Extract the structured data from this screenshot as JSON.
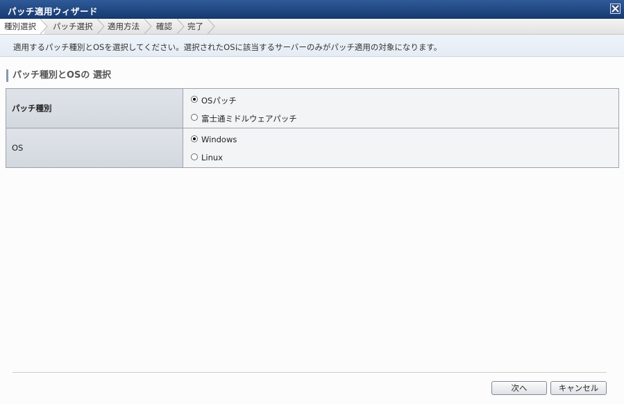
{
  "window": {
    "title": "パッチ適用ウィザード"
  },
  "steps": [
    {
      "label": "種別選択",
      "active": true
    },
    {
      "label": "パッチ選択",
      "active": false
    },
    {
      "label": "適用方法",
      "active": false
    },
    {
      "label": "確認",
      "active": false
    },
    {
      "label": "完了",
      "active": false
    }
  ],
  "instruction": "適用するパッチ種別とOSを選択してください。選択されたOSに該当するサーバーのみがパッチ適用の対象になります。",
  "section": {
    "title": "パッチ種別とOSの 選択"
  },
  "form": {
    "patch_type": {
      "label": "パッチ種別",
      "options": [
        {
          "label": "OSパッチ",
          "selected": true
        },
        {
          "label": "富士通ミドルウェアパッチ",
          "selected": false
        }
      ]
    },
    "os": {
      "label": "OS",
      "options": [
        {
          "label": "Windows",
          "selected": true
        },
        {
          "label": "Linux",
          "selected": false
        }
      ]
    }
  },
  "buttons": {
    "next": "次へ",
    "cancel": "キャンセル"
  },
  "colors": {
    "titlebar": "#1f467f",
    "instruction_bg": "#e9eff6"
  }
}
